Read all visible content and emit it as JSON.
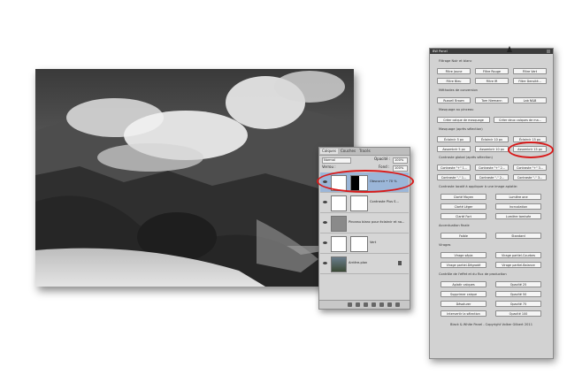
{
  "layers_panel": {
    "tabs": [
      "Calques",
      "Couches",
      "Tracés"
    ],
    "blend_mode": "Normal",
    "opacity_label": "Opacité :",
    "opacity_value": "100%",
    "lock_label": "Verrou :",
    "fill_label": "Fond :",
    "fill_value": "100%",
    "layers": [
      {
        "name": "Obscurcir • 70 %",
        "selected": true
      },
      {
        "name": "Contraste Plus S...",
        "selected": false
      },
      {
        "name": "Pinceau blanc pour éclaircir et no...",
        "selected": false
      },
      {
        "name": "Vert",
        "selected": false
      },
      {
        "name": "Arrière-plan",
        "selected": false
      }
    ]
  },
  "bw_panel": {
    "title": "BW Panel",
    "sections": [
      "Filtrage Noir et blanc",
      "Méthodes de conversion",
      "Masquage au pinceau",
      "Masquage (après sélection)",
      "Contraste global (après sélection)",
      "Contraste localé à appliquer à une image aplatie:",
      "Accentuation finale",
      "Virages",
      "Contrôle de l'effet et du flux de production"
    ],
    "buttons": {
      "filtre_jaune": "Filtre Jaune",
      "filtre_rouge": "Filtre Rouge",
      "filtre_vert": "Filtre Vert",
      "filtre_bleu": "Filtre Bleu",
      "filtre_ir": "Filtre IR",
      "filtre_densite": "Filtre Densité...",
      "russell_brown": "Russell Brown",
      "tom_niemann": "Tom Niemann",
      "lab_nb": "Lab N&B",
      "creer_calque": "Créer calque de masquage",
      "creer_deux": "Créer deux calques de ma...",
      "eclaircir_5": "Éclaircir 5 px",
      "eclaircir_10": "Éclaircir 10 px",
      "eclaircir_15": "Éclaircir 15 px",
      "assombrir_5": "Assombrir 5 px",
      "assombrir_10": "Assombrir 10 px",
      "assombrir_15": "Assombrir 15 px",
      "contraste_1": "Contraste \"+\" 1...",
      "contraste_2": "Contraste \"+\" 2...",
      "contraste_3": "Contraste \"+\" 3...",
      "contraste_4": "Contraste \"-\" 1...",
      "contraste_5": "Contraste \"-\" 2...",
      "contraste_6": "Contraste \"-\" 3...",
      "clarte_moyen": "Clarté Moyen",
      "lumiere_one": "Lumière one",
      "clarte_leger": "Clarté Léger",
      "incrustation": "Incrustation",
      "clarte_fort": "Clarté Fort",
      "lumiere_tamisee": "Lumière tamisée",
      "faible": "Faible",
      "standard": "Standard",
      "virage_sepia": "Virage sépia",
      "virage_courbes": "Virage partiel-Courbes",
      "virage_degrade": "Virage partiel-Dégradé",
      "virage_balance": "Virage partiel-Balance",
      "aplatir": "Aplatir calques",
      "opacite_25": "Opacité 25",
      "supprimer": "Supprimer calque",
      "opacite_50": "Opacité 50",
      "desaturer": "Désaturer",
      "opacite_75": "Opacité 75",
      "intervertir": "Intervertir la sélection",
      "opacite_100": "Opacité 100"
    },
    "footer": "Black & White Panel - Copyright Volker Gilbert 2011"
  },
  "colors": {
    "highlight": "#d81b1b",
    "selected_layer": "#9bb6d8",
    "panel_bg": "#d2d2d2"
  }
}
